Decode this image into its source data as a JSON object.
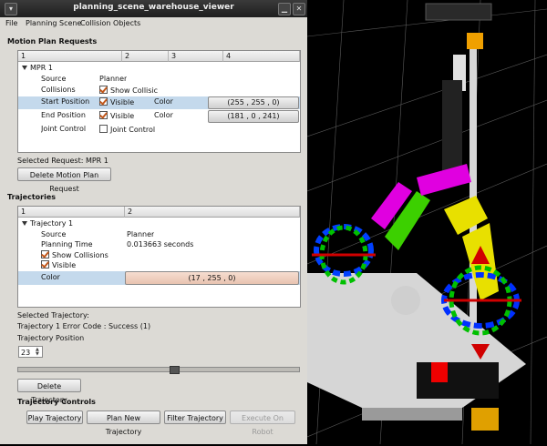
{
  "window": {
    "title": "planning_scene_warehouse_viewer"
  },
  "menubar": {
    "items": [
      "File",
      "Planning Scene",
      "Collision Objects"
    ]
  },
  "motion_plan": {
    "heading": "Motion Plan Requests",
    "columns": [
      "1",
      "2",
      "3",
      "4"
    ],
    "root_label": "MPR 1",
    "rows": {
      "source": {
        "label": "Source",
        "value": "Planner"
      },
      "collisions": {
        "label": "Collisions",
        "value": "Show Collisic"
      },
      "start": {
        "label": "Start Position",
        "visible": "Visible",
        "color_label": "Color",
        "color_value": "(255 , 255 , 0)"
      },
      "end": {
        "label": "End Position",
        "visible": "Visible",
        "color_label": "Color",
        "color_value": "(181 , 0 , 241)"
      },
      "joint": {
        "label": "Joint Control",
        "value": "Joint Control"
      }
    },
    "selected_label": "Selected Request: MPR 1",
    "delete_button": "Delete Motion Plan Request"
  },
  "trajectories": {
    "heading": "Trajectories",
    "columns": [
      "1",
      "2"
    ],
    "root_label": "Trajectory 1",
    "rows": {
      "source": {
        "label": "Source",
        "value": "Planner"
      },
      "planning_time": {
        "label": "Planning Time",
        "value": "0.013663 seconds"
      },
      "show_collisions": {
        "label": "Show Collisions"
      },
      "visible": {
        "label": "Visible"
      },
      "color": {
        "label": "Color",
        "value": "(17 , 255 , 0)"
      }
    },
    "selected_label": "Selected Trajectory:",
    "error_code": "Trajectory 1 Error Code : Success (1)",
    "position_label": "Trajectory Position",
    "position_value": "23",
    "slider_fraction": 0.56,
    "delete_button": "Delete Trajectory"
  },
  "controls": {
    "heading": "Trajectory Controls",
    "buttons": [
      "Play Trajectory",
      "Plan New Trajectory",
      "Filter Trajectory",
      "Execute On Robot"
    ]
  },
  "colors": {
    "start_swatch": "#ffff00",
    "end_swatch": "#b500f1",
    "trajectory_swatch": "#11ff00",
    "selection": "#c4d9ec"
  }
}
